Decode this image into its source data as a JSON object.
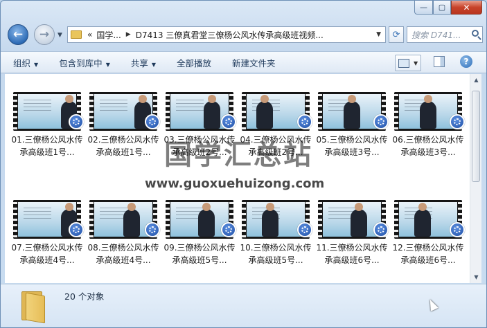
{
  "window": {
    "caption": {
      "minimize": "—",
      "maximize": "▢",
      "close": "✕"
    }
  },
  "nav": {
    "back_glyph": "←",
    "forward_glyph": "→",
    "address": {
      "overflow": "«",
      "crumbs": [
        "国学...",
        "D7413 三僚真君堂三僚杨公风水传承高级班视频..."
      ]
    },
    "refresh_glyph": "⟳",
    "search": {
      "placeholder": "搜索 D741..."
    }
  },
  "toolbar": {
    "items": [
      {
        "label": "组织",
        "dropdown": true
      },
      {
        "label": "包含到库中",
        "dropdown": true
      },
      {
        "label": "共享",
        "dropdown": true
      },
      {
        "label": "全部播放",
        "dropdown": false
      },
      {
        "label": "新建文件夹",
        "dropdown": false
      }
    ],
    "help_glyph": "?"
  },
  "files": [
    {
      "name": "01.三僚杨公风水传承高级班1号..."
    },
    {
      "name": "02.三僚杨公风水传承高级班1号..."
    },
    {
      "name": "03.三僚杨公风水传承高级班2号..."
    },
    {
      "name": "04.三僚杨公风水传承高级班2号..."
    },
    {
      "name": "05.三僚杨公风水传承高级班3号..."
    },
    {
      "name": "06.三僚杨公风水传承高级班3号..."
    },
    {
      "name": "07.三僚杨公风水传承高级班4号..."
    },
    {
      "name": "08.三僚杨公风水传承高级班4号..."
    },
    {
      "name": "09.三僚杨公风水传承高级班5号..."
    },
    {
      "name": "10.三僚杨公风水传承高级班5号..."
    },
    {
      "name": "11.三僚杨公风水传承高级班6号..."
    },
    {
      "name": "12.三僚杨公风水传承高级班6号..."
    }
  ],
  "watermark": {
    "title": "国学汇总站",
    "url": "www.guoxuehuizong.com"
  },
  "status": {
    "count_text": "20 个对象"
  },
  "scrollbar": {
    "up": "▲",
    "down": "▼"
  }
}
